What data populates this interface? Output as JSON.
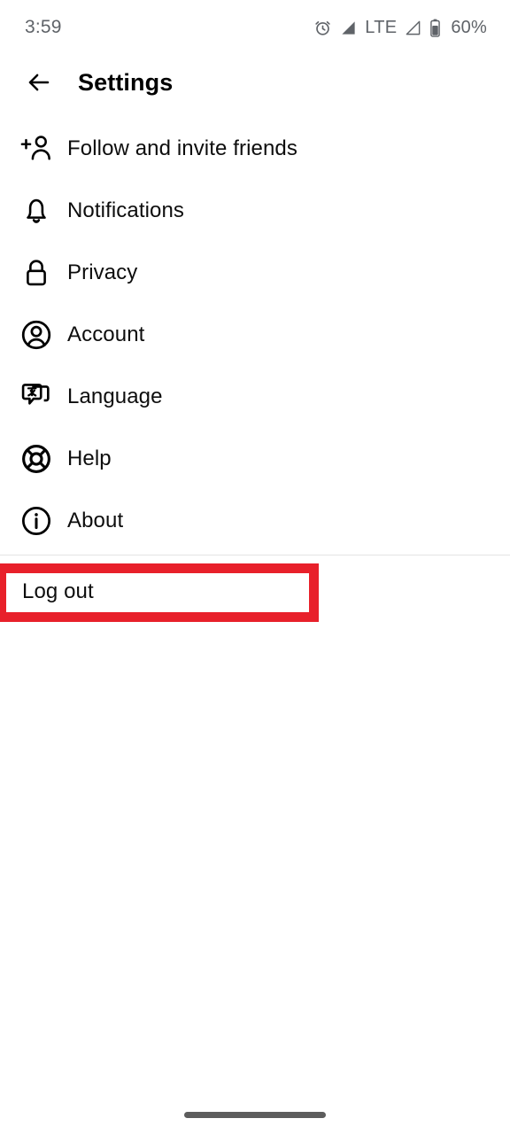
{
  "status_bar": {
    "time": "3:59",
    "alarm_icon": "alarm-clock-icon",
    "signal_icon_1": "signal-triangle-icon",
    "network_label": "LTE",
    "signal_icon_2": "signal-triangle-icon",
    "battery_icon": "battery-icon",
    "battery_percent": "60%"
  },
  "app_bar": {
    "back_icon": "back-arrow-icon",
    "title": "Settings"
  },
  "settings": {
    "items": [
      {
        "label": "Follow and invite friends",
        "icon": "person-add-icon"
      },
      {
        "label": "Notifications",
        "icon": "bell-icon"
      },
      {
        "label": "Privacy",
        "icon": "lock-icon"
      },
      {
        "label": "Account",
        "icon": "account-circle-icon"
      },
      {
        "label": "Language",
        "icon": "translate-chat-icon"
      },
      {
        "label": "Help",
        "icon": "lifebuoy-icon"
      },
      {
        "label": "About",
        "icon": "info-circle-icon"
      }
    ]
  },
  "logout": {
    "label": "Log out"
  },
  "annotation": {
    "target": "Log out",
    "color": "#e8202a"
  },
  "nav": {
    "gesture_handle": "home-gesture-handle"
  }
}
